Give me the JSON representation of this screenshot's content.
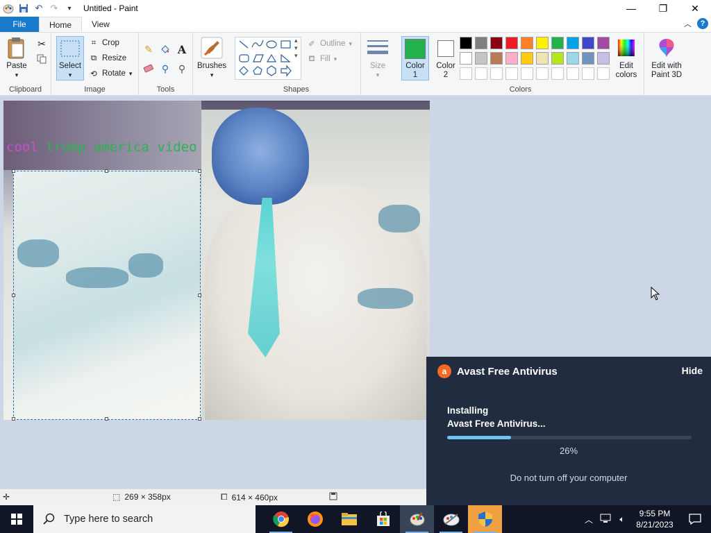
{
  "window": {
    "title": "Untitled - Paint",
    "minimize": "—",
    "maximize": "❐",
    "close": "✕"
  },
  "menu": {
    "file": "File",
    "tabs": [
      "Home",
      "View"
    ]
  },
  "ribbon": {
    "clipboard": {
      "group_label": "Clipboard",
      "paste": "Paste"
    },
    "image": {
      "group_label": "Image",
      "select": "Select",
      "crop": "Crop",
      "resize": "Resize",
      "rotate": "Rotate"
    },
    "tools": {
      "group_label": "Tools"
    },
    "brushes": {
      "label": "Brushes"
    },
    "shapes": {
      "group_label": "Shapes",
      "outline": "Outline",
      "fill": "Fill"
    },
    "size": {
      "label": "Size"
    },
    "colors": {
      "group_label": "Colors",
      "color1_label": "Color 1",
      "color2_label": "Color 2",
      "color1": "#22b14c",
      "color2": "#ffffff",
      "palette_row1": [
        "#000000",
        "#7f7f7f",
        "#880015",
        "#ed1c24",
        "#ff7f27",
        "#fff200",
        "#22b14c",
        "#00a2e8",
        "#3f48cc",
        "#a349a4"
      ],
      "palette_row2": [
        "#ffffff",
        "#c3c3c3",
        "#b97a57",
        "#ffaec9",
        "#ffc90e",
        "#efe4b0",
        "#b5e61d",
        "#99d9ea",
        "#7092be",
        "#c8bfe7"
      ],
      "edit_colors": "Edit colors",
      "edit_paint3d": "Edit with Paint 3D"
    }
  },
  "canvas": {
    "caption_word1": "cool",
    "caption_rest": " trump america video"
  },
  "status": {
    "selection_size": "269 × 358px",
    "image_size": "614 × 460px"
  },
  "avast": {
    "title": "Avast Free Antivirus",
    "hide": "Hide",
    "line1": "Installing",
    "line2": "Avast Free Antivirus...",
    "progress": 0.26,
    "percent": "26%",
    "warning": "Do not turn off your computer"
  },
  "taskbar": {
    "search_placeholder": "Type here to search",
    "time": "9:55 PM",
    "date": "8/21/2023"
  }
}
